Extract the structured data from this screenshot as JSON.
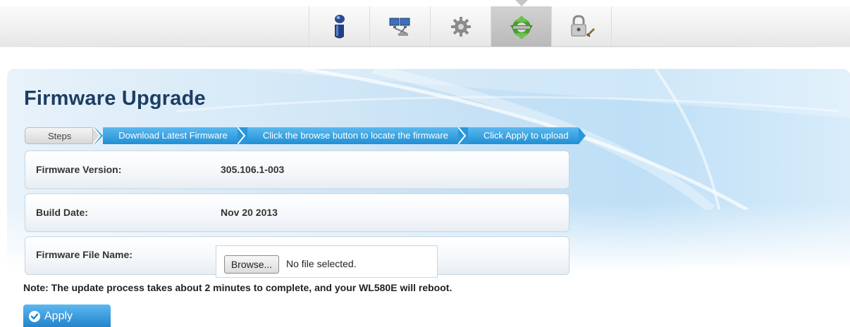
{
  "nav": {
    "tabs": [
      {
        "icon": "info-icon",
        "active": false
      },
      {
        "icon": "network-icon",
        "active": false
      },
      {
        "icon": "gear-icon",
        "active": false
      },
      {
        "icon": "firmware-update-icon",
        "active": true
      },
      {
        "icon": "lock-admin-icon",
        "active": false
      }
    ]
  },
  "page": {
    "title": "Firmware Upgrade"
  },
  "steps": {
    "first": "Steps",
    "items": [
      "Download Latest Firmware",
      "Click the browse button to locate the firmware",
      "Click Apply to upload"
    ]
  },
  "form": {
    "firmware_version_label": "Firmware Version:",
    "firmware_version_value": "305.106.1-003",
    "build_date_label": "Build Date:",
    "build_date_value": "Nov 20 2013",
    "file_name_label": "Firmware File Name:",
    "browse_label": "Browse...",
    "file_status": "No file selected."
  },
  "note": "Note: The update process takes about 2 minutes to complete, and your WL580E will reboot.",
  "apply_label": "Apply",
  "colors": {
    "title": "#1c3e63",
    "step_blue": "#1f8fd4",
    "apply_blue": "#2384cc"
  }
}
